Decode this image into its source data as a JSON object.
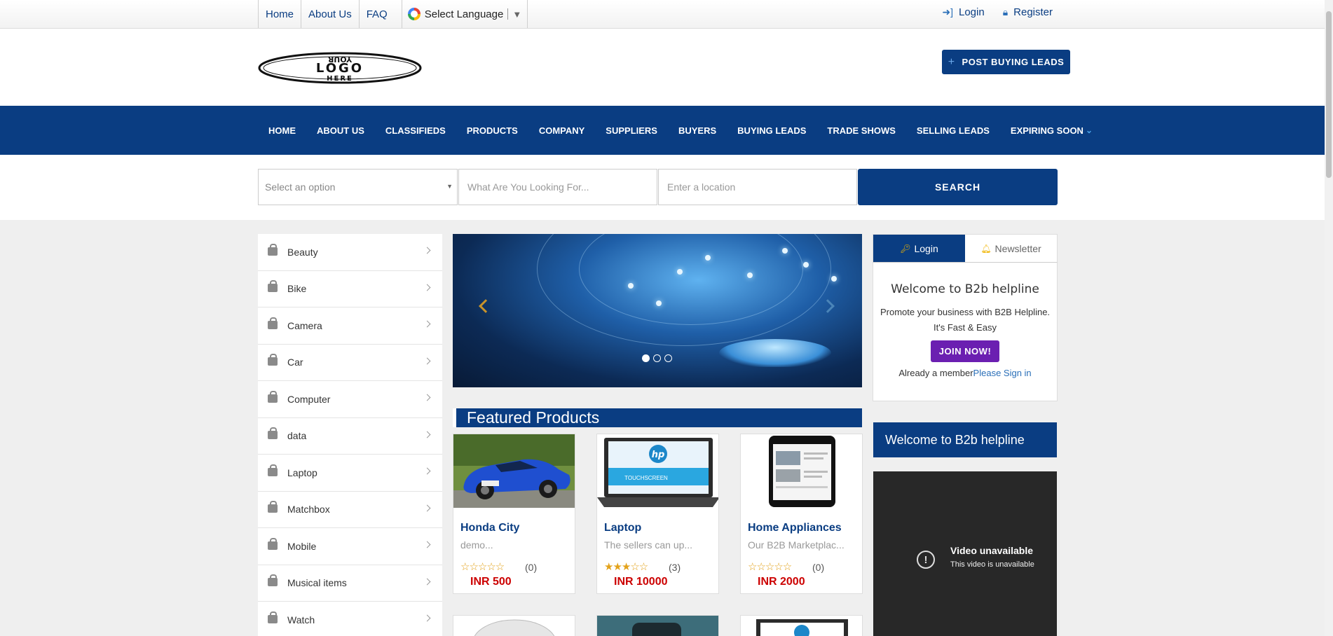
{
  "topbar": {
    "links": [
      "Home",
      "About Us",
      "FAQ"
    ],
    "language_label": "Select Language",
    "login_label": "Login",
    "register_label": "Register"
  },
  "header": {
    "logo_lines": [
      "YOUR",
      "LOGO",
      "HERE"
    ],
    "post_button": "POST BUYING LEADS"
  },
  "nav": {
    "items": [
      "HOME",
      "ABOUT US",
      "CLASSIFIEDS",
      "PRODUCTS",
      "COMPANY",
      "SUPPLIERS",
      "BUYERS",
      "BUYING LEADS",
      "TRADE SHOWS",
      "SELLING LEADS",
      "EXPIRING SOON"
    ]
  },
  "search": {
    "select_placeholder": "Select an option",
    "query_placeholder": "What Are You Looking For...",
    "location_placeholder": "Enter a location",
    "button": "SEARCH"
  },
  "categories": [
    "Beauty",
    "Bike",
    "Camera",
    "Car",
    "Computer",
    "data",
    "Laptop",
    "Matchbox",
    "Mobile",
    "Musical items",
    "Watch"
  ],
  "featured": {
    "title": "Featured Products",
    "products": [
      {
        "name": "Honda City",
        "desc": "demo...",
        "rating": 0,
        "count": "(0)",
        "price": "INR 500"
      },
      {
        "name": "Laptop",
        "desc": "The sellers can up...",
        "rating": 3,
        "count": "(3)",
        "price": "INR 10000"
      },
      {
        "name": "Home Appliances",
        "desc": "Our B2B Marketplac...",
        "rating": 0,
        "count": "(0)",
        "price": "INR 2000"
      }
    ],
    "hp_logo": "hp",
    "touchscreen_label": "TOUCHSCREEN"
  },
  "sidepanel": {
    "tab_login": "Login",
    "tab_newsletter": "Newsletter",
    "welcome_title": "Welcome to B2b helpline",
    "promo_line1": "Promote your business with B2B Helpline.",
    "promo_line2": "It's Fast & Easy",
    "join_button": "JOIN NOW!",
    "already_text": "Already a member",
    "signin_link": "Please Sign in",
    "welcome2_title": "Welcome to B2b helpline",
    "video_title": "Video unavailable",
    "video_sub": "This video is unavailable"
  },
  "colors": {
    "brand_blue": "#0a3d82",
    "join_purple": "#6b1fb1",
    "price_red": "#cc0000",
    "star_gold": "#e3a21a"
  }
}
